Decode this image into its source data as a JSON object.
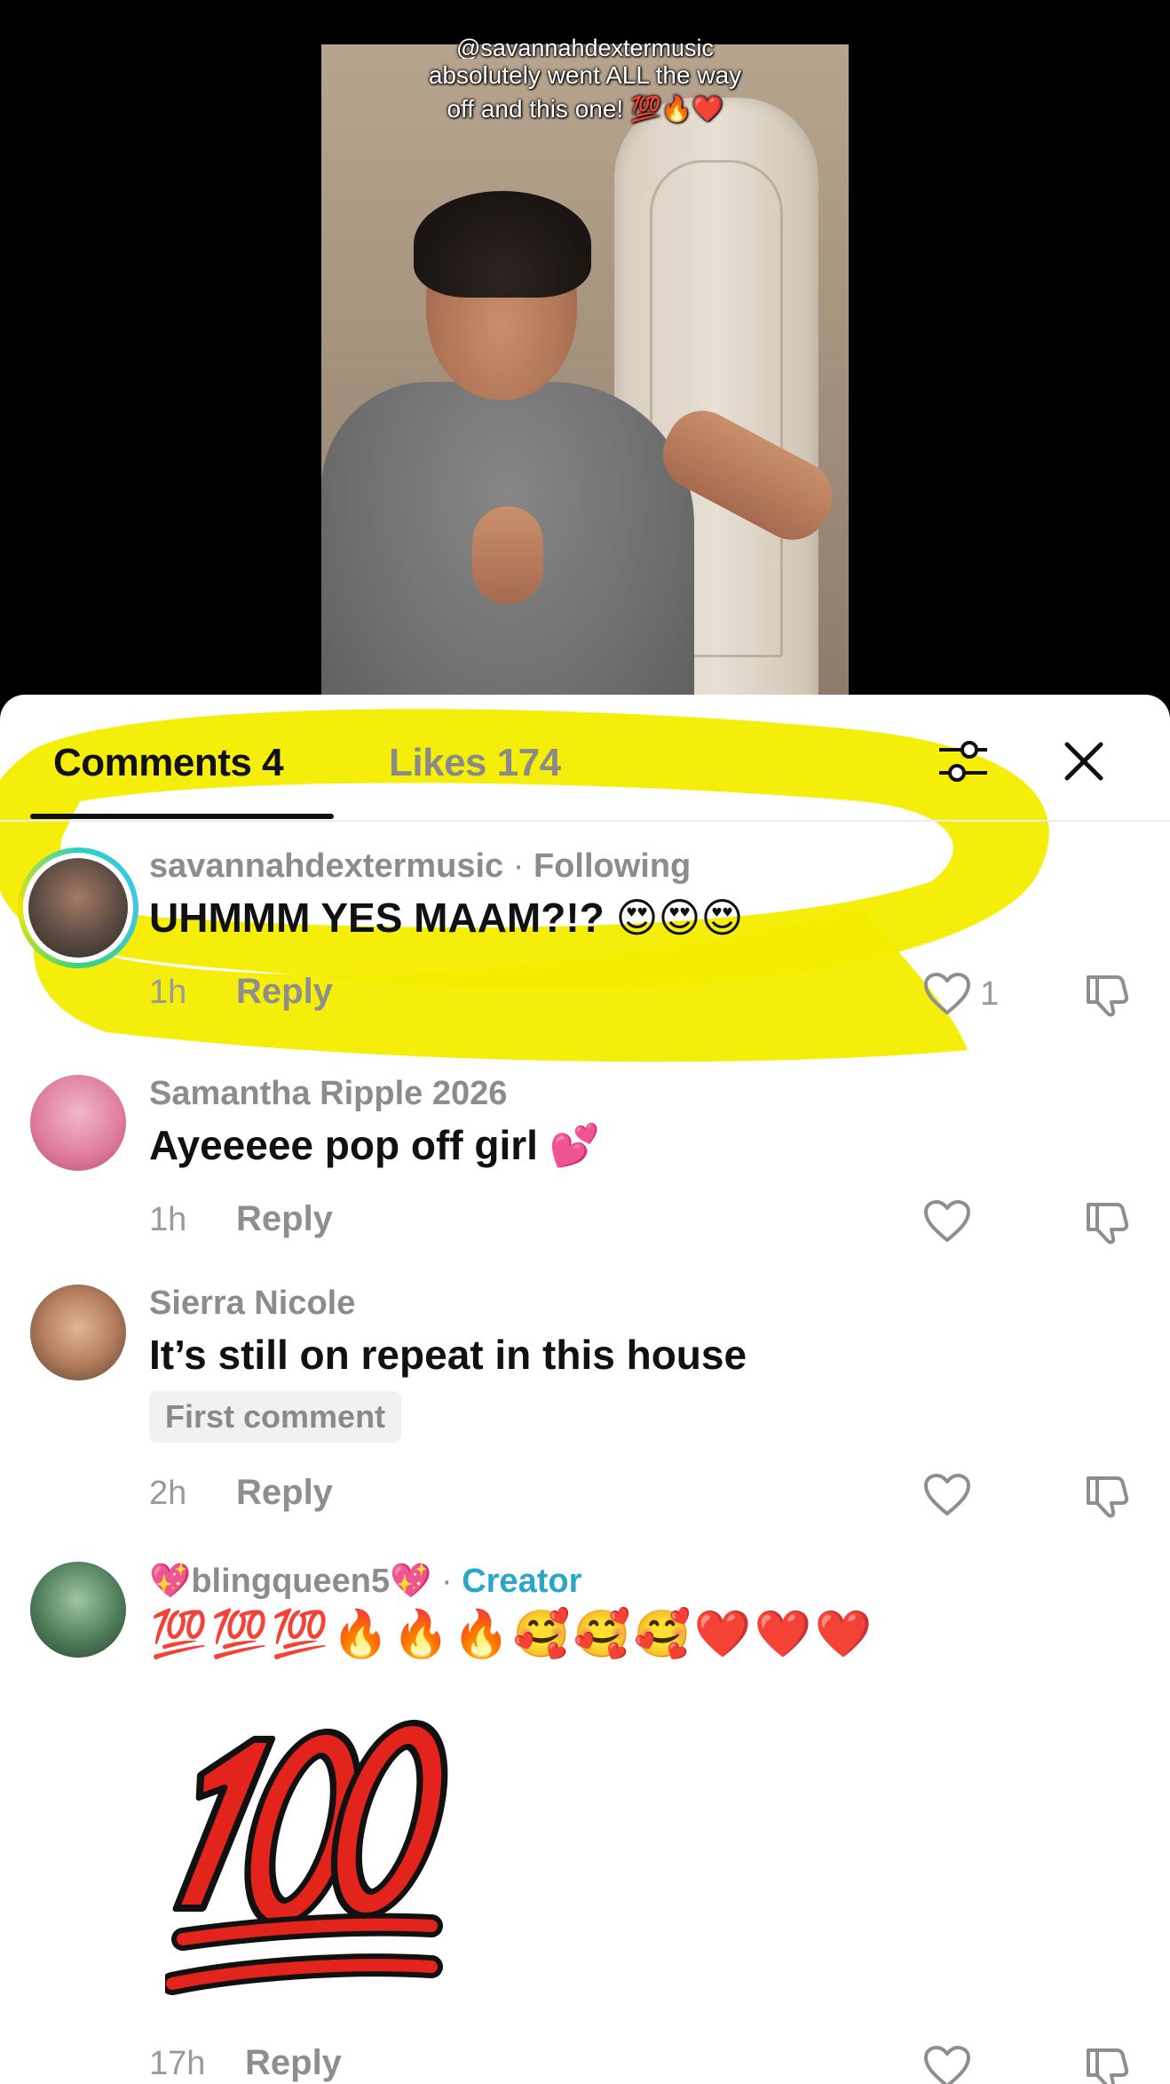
{
  "video": {
    "caption_line1": "@savannahdextermusic",
    "caption_line2": "absolutely went ALL the way",
    "caption_line3": "off and this one! 💯🔥❤️"
  },
  "tabs": {
    "comments_label": "Comments 4",
    "likes_label": "Likes 174"
  },
  "icons": {
    "filter": "filter-sliders-icon",
    "close": "close-icon",
    "heart": "heart-outline-icon",
    "dislike": "thumbs-down-icon"
  },
  "comments": [
    {
      "username": "savannahdextermusic",
      "tag": "Following",
      "text": "UHMMM YES MAAM?!? 😍😍😍",
      "time": "1h",
      "reply_label": "Reply",
      "likes": "1"
    },
    {
      "username": "Samantha Ripple 2026",
      "text": "Ayeeeee pop off girl 💕",
      "time": "1h",
      "reply_label": "Reply"
    },
    {
      "username": "Sierra Nicole",
      "text": "It’s still on repeat in this house",
      "badge": "First comment",
      "time": "2h",
      "reply_label": "Reply"
    },
    {
      "username": "💖blingqueen5💖",
      "tag": "Creator",
      "emojis": [
        "💯",
        "💯",
        "💯",
        "🔥",
        "🔥",
        "🔥",
        "🥰",
        "🥰",
        "🥰",
        "❤️",
        "❤️",
        "❤️"
      ],
      "sticker": "💯",
      "time": "17h",
      "reply_label": "Reply"
    }
  ],
  "colors": {
    "highlight": "#f5ec00",
    "creator_tag": "#2aa6c9",
    "text_primary": "#111111",
    "text_secondary": "#8c8c8c"
  }
}
